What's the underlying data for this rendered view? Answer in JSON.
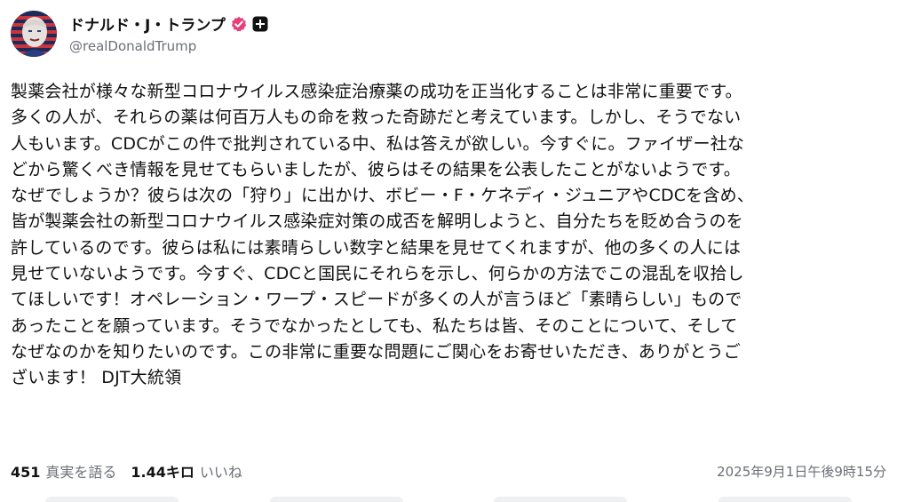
{
  "post": {
    "author": {
      "display_name": "ドナルド・J・トランプ",
      "handle": "@realDonaldTrump",
      "verified_color": "#e4407b"
    },
    "body": "製薬会社が様々な新型コロナウイルス感染症治療薬の成功を正当化することは非常に重要です。\n多くの人が、それらの薬は何百万人もの命を救った奇跡だと考えています。しかし、そうでない\n人もいます。CDCがこの件で批判されている中、私は答えが欲しい。今すぐに。ファイザー社な\nどから驚くべき情報を見せてもらいましたが、彼らはその結果を公表したことがないようです。\nなぜでしょうか？彼らは次の「狩り」に出かけ、ボビー・F・ケネディ・ジュニアやCDCを含め、\n皆が製薬会社の新型コロナウイルス感染症対策の成否を解明しようと、自分たちを貶め合うのを\n許しているのです。彼らは私には素晴らしい数字と結果を見せてくれますが、他の多くの人には\n見せていないようです。今すぐ、CDCと国民にそれらを示し、何らかの方法でこの混乱を収拾し\nてほしいです！オペレーション・ワープ・スピードが多くの人が言うほど「素晴らしい」もので\nあったことを願っています。そうでなかったとしても、私たちは皆、そのことについて、そして\nなぜなのかを知りたいのです。この非常に重要な問題にご関心をお寄せいただき、ありがとうご\nざいます！ DJT大統領",
    "stats": {
      "retruths_count": "451",
      "retruths_label": "真実を語る",
      "likes_count": "1.44キロ",
      "likes_label": "いいね"
    },
    "timestamp": "2025年9月1日午後9時15分"
  },
  "icons": {
    "verified": "verified-badge-icon",
    "follow": "plus-icon"
  }
}
